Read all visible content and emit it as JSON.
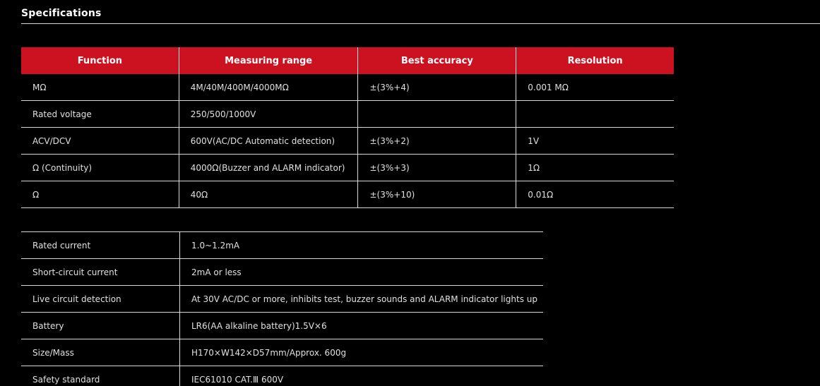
{
  "section": {
    "title": "Specifications"
  },
  "spec_table": {
    "headers": [
      "Function",
      "Measuring range",
      "Best accuracy",
      "Resolution"
    ],
    "rows": [
      [
        "MΩ",
        "4M/40M/400M/4000MΩ",
        "±(3%+4)",
        "0.001 MΩ"
      ],
      [
        "Rated voltage",
        "250/500/1000V",
        "",
        ""
      ],
      [
        "ACV/DCV",
        "600V(AC/DC Automatic detection)",
        "±(3%+2)",
        "1V"
      ],
      [
        "Ω (Continuity)",
        "4000Ω(Buzzer and ALARM indicator)",
        "±(3%+3)",
        "1Ω"
      ],
      [
        "Ω",
        "40Ω",
        "±(3%+10)",
        "0.01Ω"
      ]
    ]
  },
  "info_table": {
    "rows": [
      [
        "Rated current",
        "1.0~1.2mA"
      ],
      [
        "Short-circuit current",
        "2mA or less"
      ],
      [
        "Live circuit detection",
        "At 30V AC/DC or more, inhibits test, buzzer sounds and ALARM indicator lights up"
      ],
      [
        "Battery",
        "LR6(AA alkaline battery)1.5V×6"
      ],
      [
        "Size/Mass",
        "H170×W142×D57mm/Approx. 600g"
      ],
      [
        "Safety standard",
        "IEC61010 CAT.Ⅲ 600V"
      ]
    ]
  },
  "colors": {
    "header_bg": "#cc1120",
    "page_bg": "#000000",
    "text": "#e0e0e0"
  }
}
